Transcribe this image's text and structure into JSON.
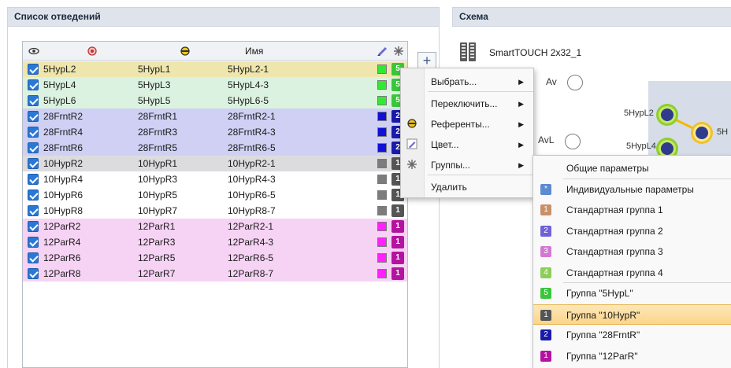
{
  "left_panel": {
    "title": "Список отведений"
  },
  "right_panel": {
    "title": "Схема",
    "device_name": "SmartTOUCH 2x32_1"
  },
  "table": {
    "headers": {
      "visible": "eye-icon",
      "electrode": "electrode-icon",
      "reference": "reference-icon",
      "name": "Имя",
      "color": "pen-icon",
      "group": "snowflake-icon"
    },
    "rows": [
      {
        "checked": true,
        "a": "5HypL2",
        "b": "5HypL1",
        "name": "5HypL2-1",
        "row_bg": "#efe6ad",
        "swatch": "#33e833",
        "group": "5",
        "group_color": "#3ac53a"
      },
      {
        "checked": true,
        "a": "5HypL4",
        "b": "5HypL3",
        "name": "5HypL4-3",
        "row_bg": "#dcf2e0",
        "swatch": "#33e833",
        "group": "5",
        "group_color": "#3ac53a"
      },
      {
        "checked": true,
        "a": "5HypL6",
        "b": "5HypL5",
        "name": "5HypL6-5",
        "row_bg": "#dcf2e0",
        "swatch": "#33e833",
        "group": "5",
        "group_color": "#3ac53a"
      },
      {
        "checked": true,
        "a": "28FrntR2",
        "b": "28FrntR1",
        "name": "28FrntR2-1",
        "row_bg": "#cfd0f4",
        "swatch": "#1010d8",
        "group": "2",
        "group_color": "#1a1aa8"
      },
      {
        "checked": true,
        "a": "28FrntR4",
        "b": "28FrntR3",
        "name": "28FrntR4-3",
        "row_bg": "#cfd0f4",
        "swatch": "#1010d8",
        "group": "2",
        "group_color": "#1a1aa8"
      },
      {
        "checked": true,
        "a": "28FrntR6",
        "b": "28FrntR5",
        "name": "28FrntR6-5",
        "row_bg": "#cfd0f4",
        "swatch": "#1010d8",
        "group": "2",
        "group_color": "#1a1aa8"
      },
      {
        "checked": true,
        "a": "10HypR2",
        "b": "10HypR1",
        "name": "10HypR2-1",
        "row_bg": "#dcdcdf",
        "swatch": "#7c7c7c",
        "group": "1",
        "group_color": "#555555"
      },
      {
        "checked": true,
        "a": "10HypR4",
        "b": "10HypR3",
        "name": "10HypR4-3",
        "row_bg": "#ffffff",
        "swatch": "#7c7c7c",
        "group": "1",
        "group_color": "#555555"
      },
      {
        "checked": true,
        "a": "10HypR6",
        "b": "10HypR5",
        "name": "10HypR6-5",
        "row_bg": "#ffffff",
        "swatch": "#7c7c7c",
        "group": "1",
        "group_color": "#555555"
      },
      {
        "checked": true,
        "a": "10HypR8",
        "b": "10HypR7",
        "name": "10HypR8-7",
        "row_bg": "#ffffff",
        "swatch": "#7c7c7c",
        "group": "1",
        "group_color": "#555555"
      },
      {
        "checked": true,
        "a": "12ParR2",
        "b": "12ParR1",
        "name": "12ParR2-1",
        "row_bg": "#f6d3f4",
        "swatch": "#ff22ff",
        "group": "1",
        "group_color": "#b4139f"
      },
      {
        "checked": true,
        "a": "12ParR4",
        "b": "12ParR3",
        "name": "12ParR4-3",
        "row_bg": "#f6d3f4",
        "swatch": "#ff22ff",
        "group": "1",
        "group_color": "#b4139f"
      },
      {
        "checked": true,
        "a": "12ParR6",
        "b": "12ParR5",
        "name": "12ParR6-5",
        "row_bg": "#f6d3f4",
        "swatch": "#ff22ff",
        "group": "1",
        "group_color": "#b4139f"
      },
      {
        "checked": true,
        "a": "12ParR8",
        "b": "12ParR7",
        "name": "12ParR8-7",
        "row_bg": "#f6d3f4",
        "swatch": "#ff22ff",
        "group": "1",
        "group_color": "#b4139f"
      }
    ]
  },
  "add_button": {
    "label": "+"
  },
  "scheme": {
    "radio_av": "Av",
    "radio_avl": "AvL",
    "node_1": "5HypL2",
    "node_2": "5HypL4",
    "node_3": "5H"
  },
  "context_menu": {
    "items": [
      {
        "label": "Выбрать...",
        "icon": "",
        "submenu": true
      },
      {
        "label": "Переключить...",
        "icon": "",
        "submenu": true
      },
      {
        "label": "Референты...",
        "icon": "reference-icon",
        "submenu": true
      },
      {
        "label": "Цвет...",
        "icon": "pen-icon",
        "submenu": true
      },
      {
        "label": "Группы...",
        "icon": "snowflake-icon",
        "submenu": true
      },
      {
        "label": "Удалить",
        "icon": "",
        "submenu": false
      }
    ]
  },
  "group_menu": {
    "items": [
      {
        "label": "Общие параметры",
        "badge": "",
        "color": ""
      },
      {
        "label": "Индивидуальные параметры",
        "badge": "*",
        "color": "#5b8bd1"
      },
      {
        "label": "Стандартная группа 1",
        "badge": "1",
        "color": "#c8906a"
      },
      {
        "label": "Стандартная группа 2",
        "badge": "2",
        "color": "#6f62d6"
      },
      {
        "label": "Стандартная группа 3",
        "badge": "3",
        "color": "#d27ad2"
      },
      {
        "label": "Стандартная группа 4",
        "badge": "4",
        "color": "#8ccd5b"
      },
      {
        "label": "Группа \"5HypL\"",
        "badge": "5",
        "color": "#3ac53a"
      },
      {
        "label": "Группа \"10HypR\"",
        "badge": "1",
        "color": "#555555",
        "active": true
      },
      {
        "label": "Группа \"28FrntR\"",
        "badge": "2",
        "color": "#1a1aa8"
      },
      {
        "label": "Группа \"12ParR\"",
        "badge": "1",
        "color": "#b4139f"
      }
    ]
  }
}
